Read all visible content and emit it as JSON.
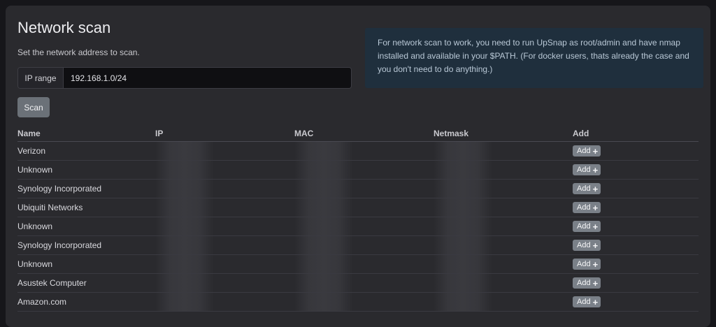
{
  "header": {
    "title": "Network scan",
    "subtitle": "Set the network address to scan."
  },
  "form": {
    "ip_label": "IP range",
    "ip_value": "192.168.1.0/24",
    "scan_label": "Scan"
  },
  "info": {
    "text": "For network scan to work, you need to run UpSnap as root/admin and have nmap installed and available in your $PATH. (For docker users, thats already the case and you don't need to do anything.)"
  },
  "table": {
    "headers": [
      "Name",
      "IP",
      "MAC",
      "Netmask",
      "Add"
    ],
    "add_label": "Add",
    "rows": [
      {
        "name": "Verizon"
      },
      {
        "name": "Unknown"
      },
      {
        "name": "Synology Incorporated"
      },
      {
        "name": "Ubiquiti Networks"
      },
      {
        "name": "Unknown"
      },
      {
        "name": "Synology Incorporated"
      },
      {
        "name": "Unknown"
      },
      {
        "name": "Asustek Computer"
      },
      {
        "name": "Amazon.com"
      }
    ]
  },
  "colors": {
    "background": "#16161a",
    "card": "#2a2a2e",
    "info_bg": "#1f2f3d",
    "button": "#6b7178"
  },
  "icons": {
    "add": "plus-icon"
  }
}
